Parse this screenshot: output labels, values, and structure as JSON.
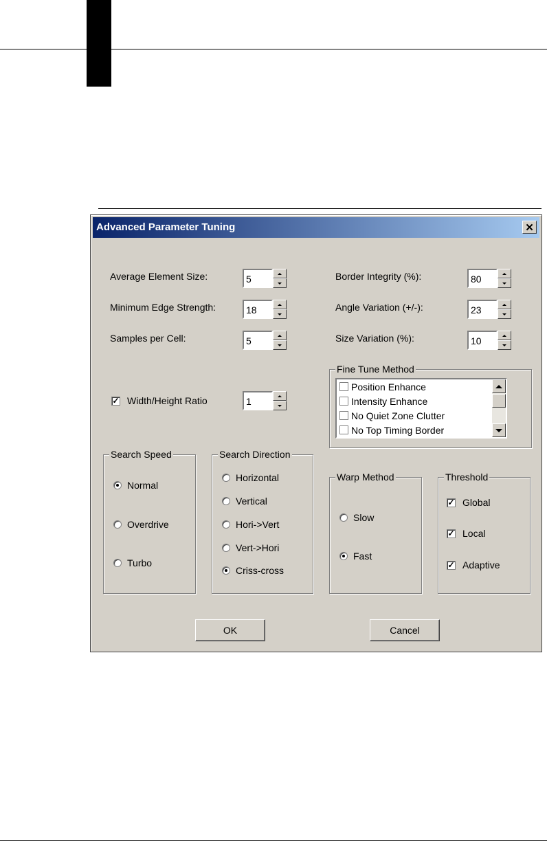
{
  "dialog": {
    "title": "Advanced Parameter Tuning",
    "close_glyph": "✕"
  },
  "fields": {
    "avg_element_size": {
      "label": "Average Element Size:",
      "value": "5"
    },
    "min_edge_strength": {
      "label": "Minimum Edge Strength:",
      "value": "18"
    },
    "samples_per_cell": {
      "label": "Samples per Cell:",
      "value": "5"
    },
    "border_integrity": {
      "label": "Border Integrity (%):",
      "value": "80"
    },
    "angle_variation": {
      "label": "Angle Variation (+/-):",
      "value": "23"
    },
    "size_variation": {
      "label": "Size Variation (%):",
      "value": "10"
    },
    "wh_ratio": {
      "label": "Width/Height Ratio",
      "value": "1",
      "checked": true
    }
  },
  "fine_tune": {
    "title": "Fine Tune Method",
    "items": [
      "Position Enhance",
      "Intensity Enhance",
      "No Quiet Zone Clutter",
      "No Top Timing Border"
    ]
  },
  "search_speed": {
    "title": "Search Speed",
    "options": [
      "Normal",
      "Overdrive",
      "Turbo"
    ],
    "selected": "Normal"
  },
  "search_direction": {
    "title": "Search Direction",
    "options": [
      "Horizontal",
      "Vertical",
      "Hori->Vert",
      "Vert->Hori",
      "Criss-cross"
    ],
    "selected": "Criss-cross"
  },
  "warp_method": {
    "title": "Warp Method",
    "options": [
      "Slow",
      "Fast"
    ],
    "selected": "Fast"
  },
  "threshold": {
    "title": "Threshold",
    "options": [
      "Global",
      "Local",
      "Adaptive"
    ],
    "checked": [
      true,
      true,
      true
    ]
  },
  "buttons": {
    "ok": "OK",
    "cancel": "Cancel"
  },
  "check_glyph": "✓"
}
